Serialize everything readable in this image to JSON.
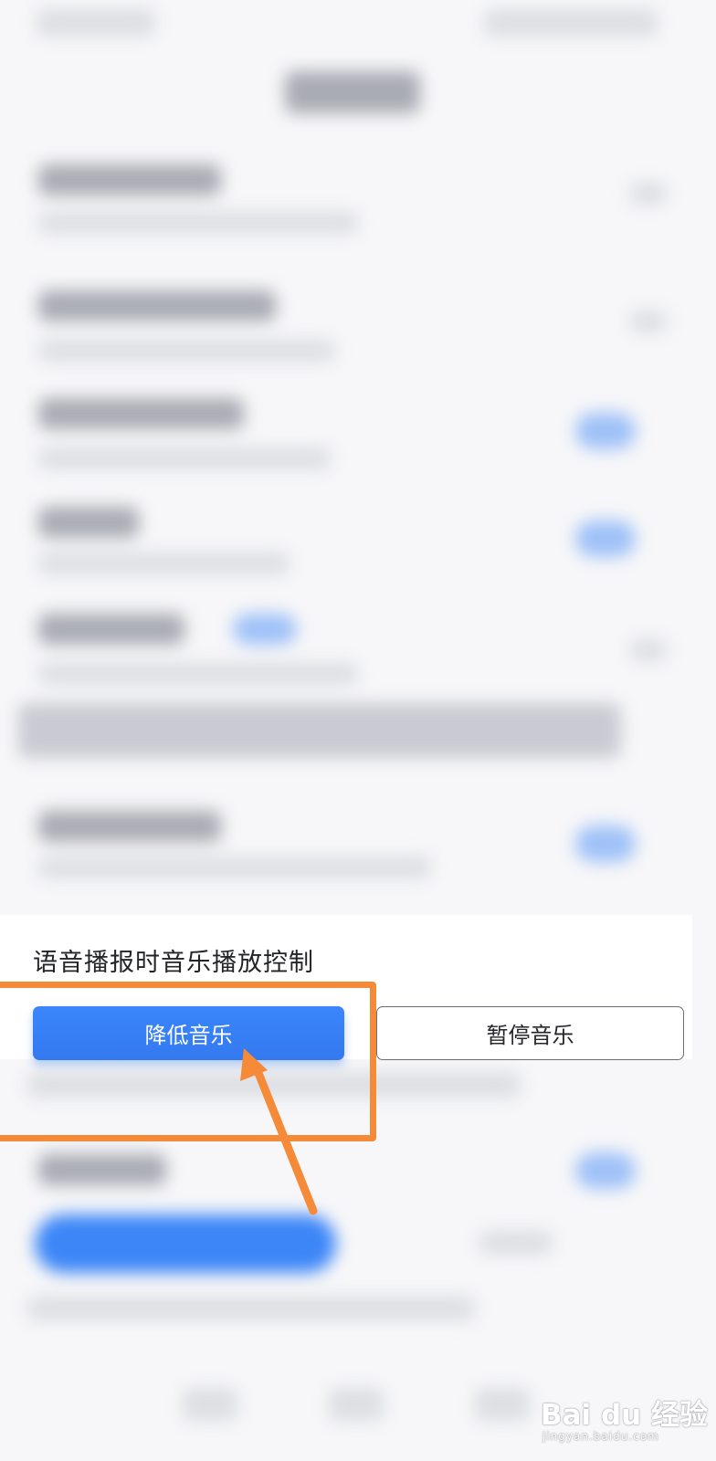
{
  "popup": {
    "title": "语音播报时音乐播放控制",
    "buttons": [
      {
        "label": "降低音乐",
        "state": "selected",
        "color": "#3a86fb"
      },
      {
        "label": "暂停音乐",
        "state": "unselected"
      }
    ]
  },
  "annotation": {
    "color": "#f58a39",
    "target": "降低音乐"
  },
  "watermark": {
    "logo": "Bai du 经验",
    "url": "jingyan.baidu.com"
  }
}
